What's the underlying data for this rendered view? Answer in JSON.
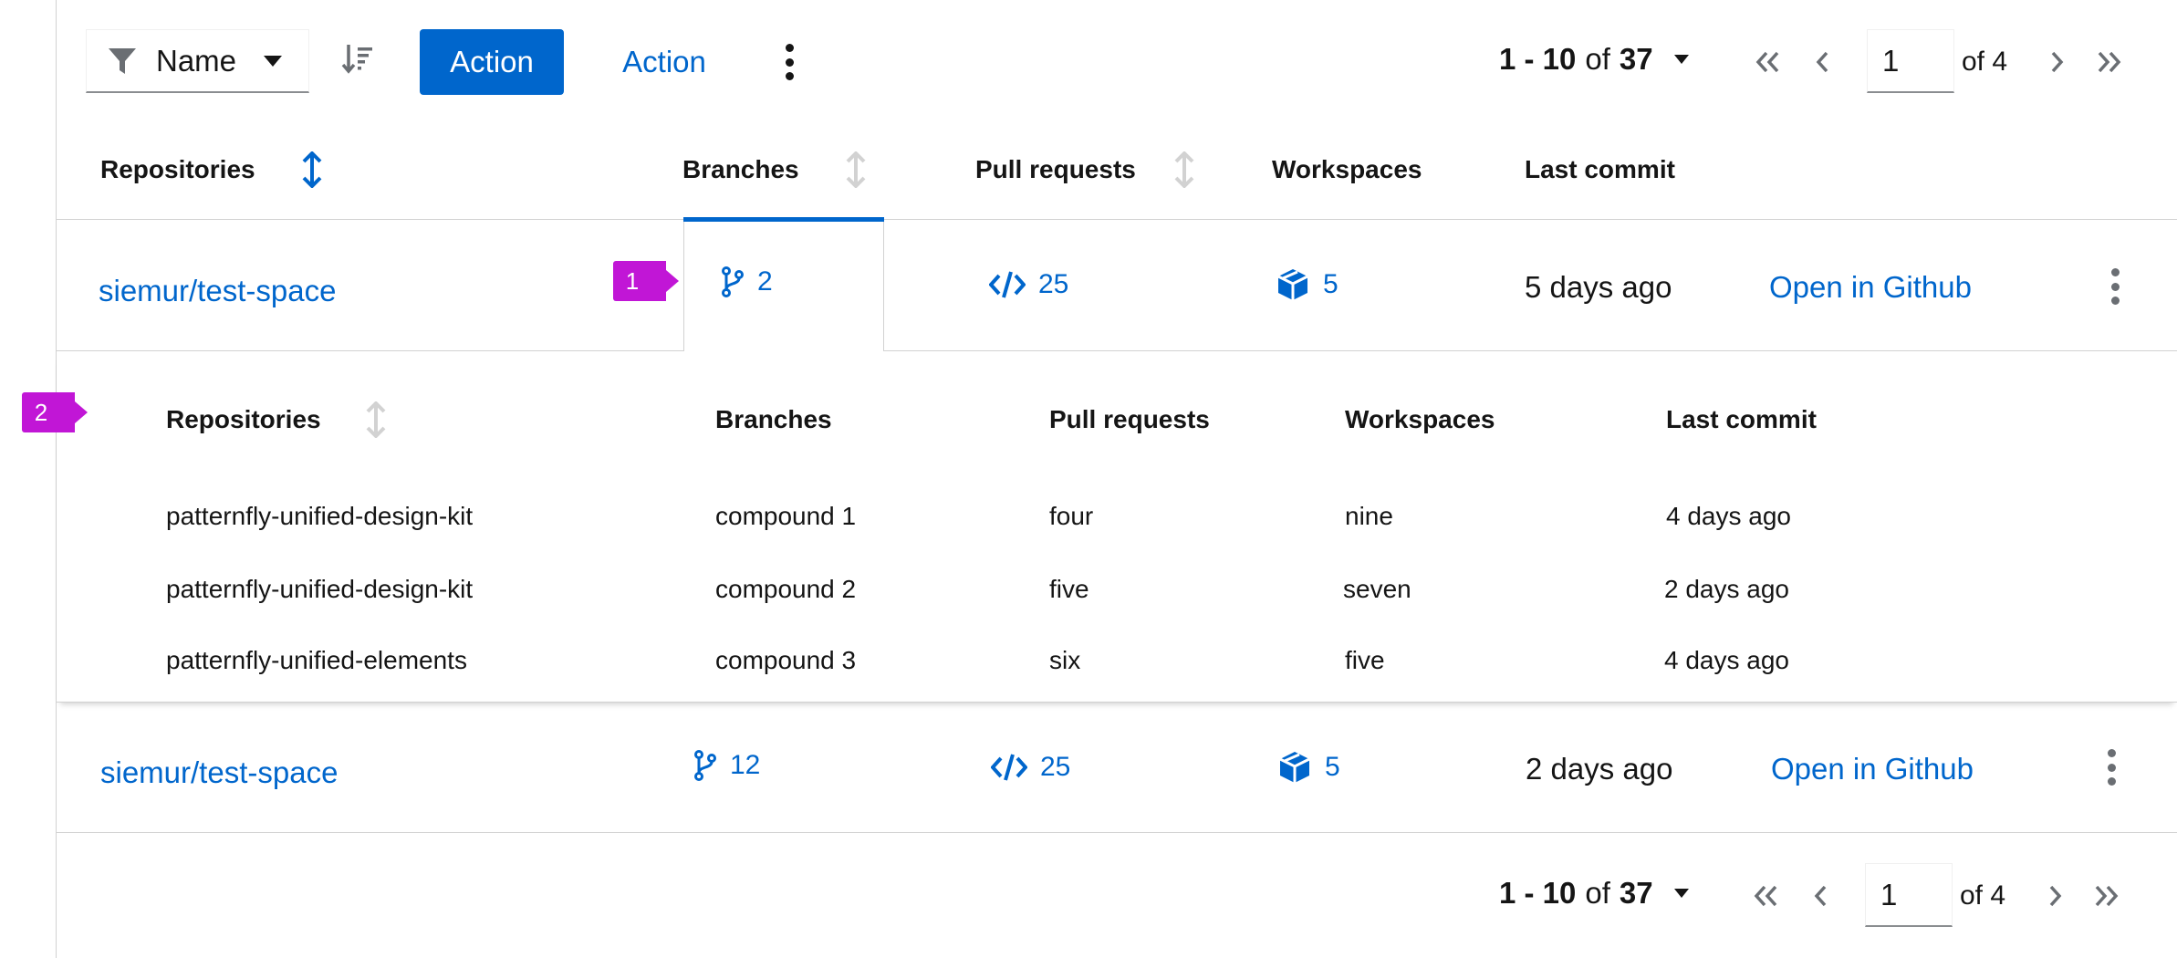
{
  "toolbar": {
    "filter_label": "Name",
    "primary_action": "Action",
    "secondary_action": "Action"
  },
  "pagination": {
    "range": "1 - 10",
    "of_label": "of",
    "total": "37",
    "page": "1",
    "page_total": "of 4"
  },
  "table": {
    "headers": {
      "repositories": "Repositories",
      "branches": "Branches",
      "pull_requests": "Pull requests",
      "workspaces": "Workspaces",
      "last_commit": "Last commit"
    },
    "rows": [
      {
        "repo": "siemur/test-space",
        "branches": "2",
        "pull_requests": "25",
        "workspaces": "5",
        "last_commit": "5 days ago",
        "action": "Open in Github"
      },
      {
        "repo": "siemur/test-space",
        "branches": "12",
        "pull_requests": "25",
        "workspaces": "5",
        "last_commit": "2 days ago",
        "action": "Open in Github"
      }
    ]
  },
  "nested": {
    "headers": {
      "repositories": "Repositories",
      "branches": "Branches",
      "pull_requests": "Pull requests",
      "workspaces": "Workspaces",
      "last_commit": "Last commit"
    },
    "rows": [
      {
        "repo": "patternfly-unified-design-kit",
        "branches": "compound 1",
        "pull_requests": "four",
        "workspaces": "nine",
        "last_commit": "4 days ago"
      },
      {
        "repo": "patternfly-unified-design-kit",
        "branches": "compound 2",
        "pull_requests": "five",
        "workspaces": "seven",
        "last_commit": "2 days ago"
      },
      {
        "repo": "patternfly-unified-elements",
        "branches": "compound 3",
        "pull_requests": "six",
        "workspaces": "five",
        "last_commit": "4 days ago"
      }
    ]
  },
  "annotations": {
    "marker_1": "1",
    "marker_2": "2"
  },
  "colors": {
    "accent": "#0066cc",
    "marker": "#c116d6",
    "border": "#d2d2d2"
  },
  "icons": [
    "filter-icon",
    "caret-down-icon",
    "sort-amount-down-icon",
    "kebab-icon",
    "angle-double-left-icon",
    "angle-left-icon",
    "angle-right-icon",
    "angle-double-right-icon",
    "sort-icon",
    "code-branch-icon",
    "code-icon",
    "cube-icon"
  ]
}
